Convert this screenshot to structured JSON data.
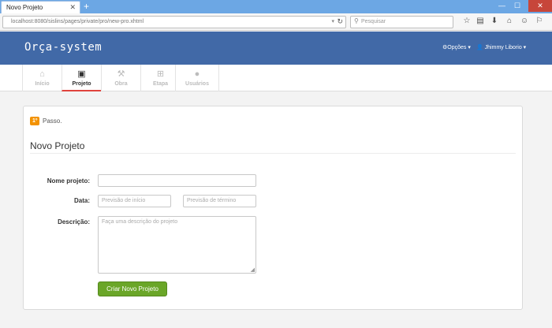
{
  "browser": {
    "tab_title": "Novo Projeto",
    "tab_close": "✕",
    "new_tab": "+",
    "url": "localhost:8080/sislins/pages/private/pro/new-pro.xhtml",
    "search_placeholder": "Pesquisar",
    "window_controls": {
      "minimize": "—",
      "maximize": "☐",
      "close": "✕"
    },
    "toolbar_icons": [
      "bookmark-star-icon",
      "reading-list-icon",
      "download-icon",
      "home-icon",
      "chat-icon",
      "pocket-icon"
    ]
  },
  "header": {
    "brand": "Orça-system",
    "options_menu": "⚙Opções ▾",
    "user_menu": "👤 Jhimmy Liborio ▾"
  },
  "modules": [
    {
      "label": "Início",
      "icon": "home-icon",
      "glyph": "⌂"
    },
    {
      "label": "Projeto",
      "icon": "briefcase-icon",
      "glyph": "▣"
    },
    {
      "label": "Obra",
      "icon": "hammer-icon",
      "glyph": "⚒"
    },
    {
      "label": "Etapa",
      "icon": "steps-icon",
      "glyph": "⊞"
    },
    {
      "label": "Usuários",
      "icon": "user-icon",
      "glyph": "●"
    }
  ],
  "active_module": "Projeto",
  "form": {
    "step_badge": "1º",
    "step_text": "Passo.",
    "title": "Novo Projeto",
    "name_label": "Nome projeto:",
    "name_value": "",
    "date_label": "Data:",
    "date_start_placeholder": "Previsão de início",
    "date_end_placeholder": "Previsão de término",
    "description_label": "Descrição:",
    "description_placeholder": "Faça uma descrição do projeto",
    "submit_label": "Criar Novo Projeto"
  },
  "colors": {
    "header_bg": "#4169a7",
    "active_tab_underline": "#e0433d",
    "step_badge": "#f39200",
    "submit_button": "#6aa628"
  }
}
